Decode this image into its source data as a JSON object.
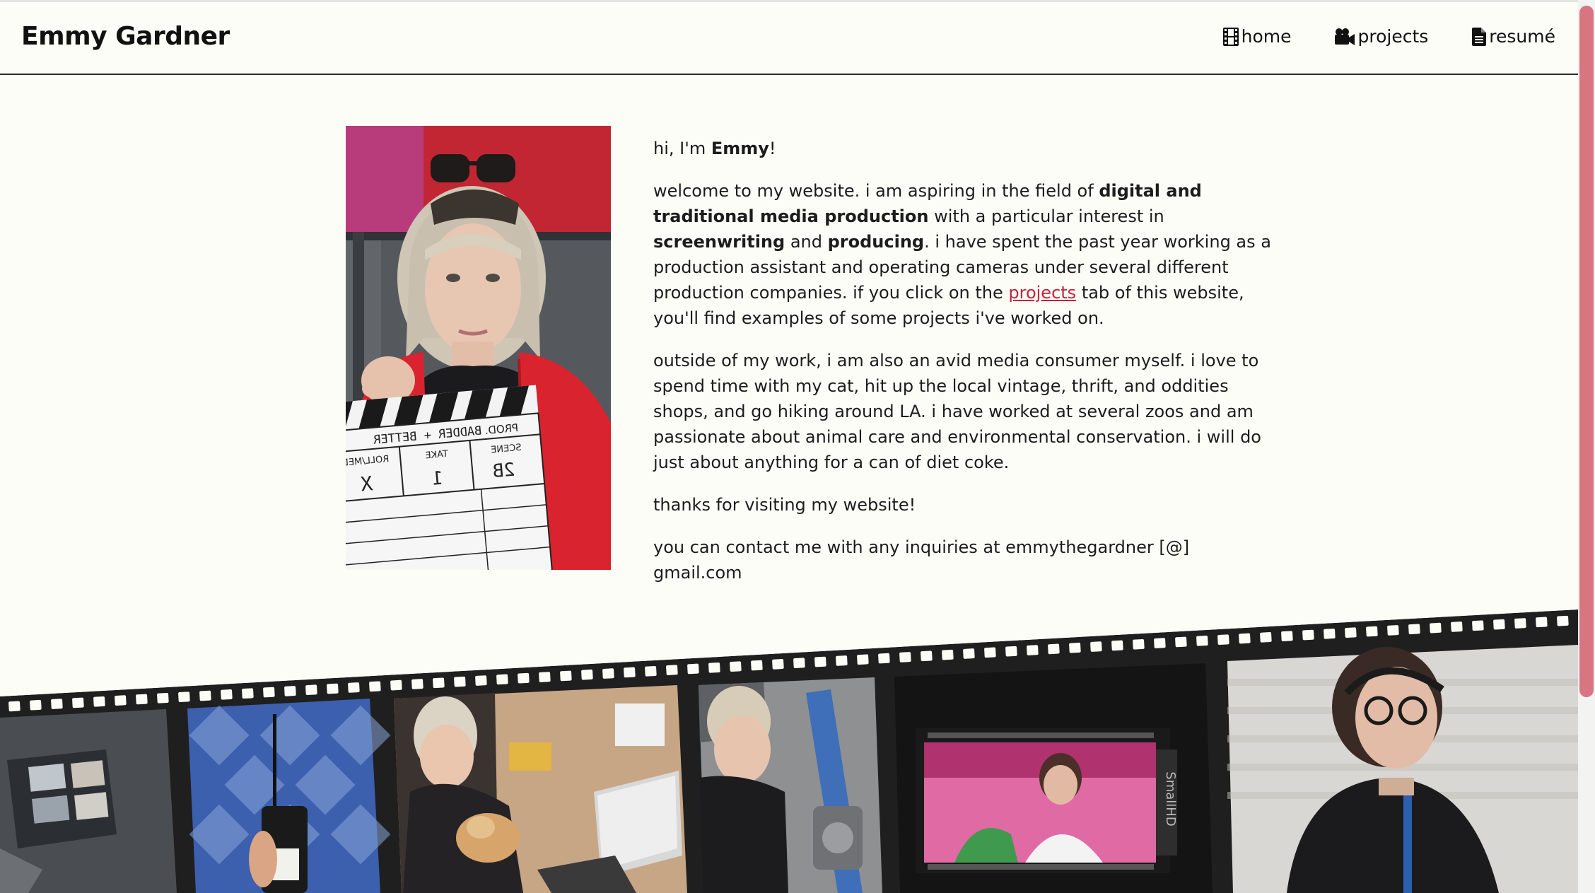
{
  "site": {
    "title": "Emmy Gardner"
  },
  "nav": [
    {
      "label": "home",
      "icon": "film-icon"
    },
    {
      "label": "projects",
      "icon": "video-camera-icon"
    },
    {
      "label": "resumé",
      "icon": "document-icon"
    }
  ],
  "bio": {
    "greeting_pre": "hi, I'm ",
    "greeting_name": "Emmy",
    "greeting_post": "!",
    "p2_a": "welcome to my website. i am aspiring in the field of ",
    "p2_b": "digital and traditional media production",
    "p2_c": " with a particular interest in ",
    "p2_d": "screenwriting",
    "p2_e": " and ",
    "p2_f": "producing",
    "p2_g": ". i have spent the past year working as a production assistant and operating cameras under several different production companies. if you click on the ",
    "p2_link": "projects",
    "p2_h": " tab of this website, you'll find examples of some projects i've worked on.",
    "p3": "outside of my work, i am also an avid media consumer myself. i love to spend time with my cat, hit up the local vintage, thrift, and oddities shops, and go hiking around LA. i have worked at several zoos and am passionate about animal care and environmental conservation. i will do just about anything for a can of diet coke.",
    "p4": "thanks for visiting my website!",
    "p5": "you can contact me with any inquiries at emmythegardner [@] gmail.com"
  },
  "colors": {
    "background": "#fdfdf8",
    "link": "#c4243a",
    "scrollbar_thumb": "#d97581",
    "film": "#1f1f1f"
  },
  "portrait": {
    "slate": {
      "prod": "PROD.",
      "title": "BADDER + BETTER",
      "scene": "SCENE",
      "scene_value": "2B",
      "take": "TAKE",
      "take_value": "1",
      "roll": "ROLL/MEDIA",
      "roll_value": "X"
    }
  },
  "film_frames": [
    {
      "name": "film-frame-switcher-monitors"
    },
    {
      "name": "film-frame-walkie-talkie"
    },
    {
      "name": "film-frame-laptop-cat"
    },
    {
      "name": "film-frame-camera-rig"
    },
    {
      "name": "film-frame-smallhd-monitor",
      "monitor_text": "SmallHD"
    },
    {
      "name": "film-frame-headset-portrait"
    }
  ]
}
